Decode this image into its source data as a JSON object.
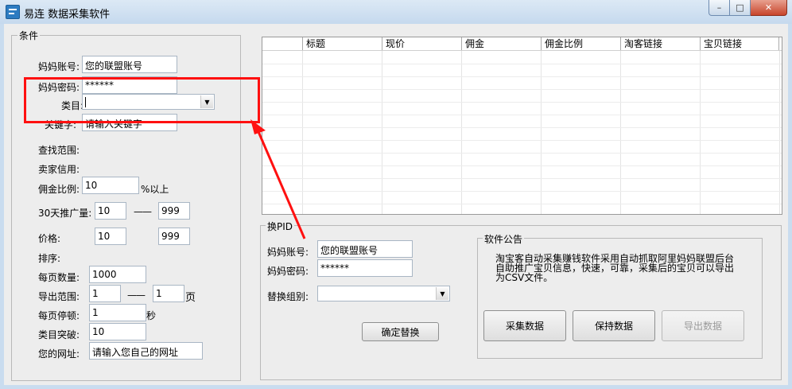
{
  "window": {
    "title": "易连 数据采集软件",
    "min": "–",
    "max": "□",
    "close": "✕"
  },
  "conditions": {
    "group_title": "条件",
    "mama_account": {
      "label": "妈妈账号:",
      "value": "您的联盟账号"
    },
    "mama_password": {
      "label": "妈妈密码:",
      "value": "******"
    },
    "category": {
      "label": "类目:",
      "value": ""
    },
    "keyword": {
      "label": "关键字:",
      "value": "请输入关键字"
    },
    "search_range_label": "查找范围:",
    "seller_credit_label": "卖家信用:",
    "commission_ratio": {
      "label": "佣金比例:",
      "value": "10",
      "suffix": "%以上"
    },
    "promo_30d": {
      "label": "30天推广量:",
      "from": "10",
      "sep": "——",
      "to": "999"
    },
    "price": {
      "label": "价格:",
      "from": "10",
      "to": "999"
    },
    "sort_label": "排序:",
    "per_page": {
      "label": "每页数量:",
      "value": "1000"
    },
    "export_range": {
      "label": "导出范围:",
      "from": "1",
      "sep": "——",
      "to": "1",
      "unit": "页"
    },
    "page_pause": {
      "label": "每页停顿:",
      "value": "1",
      "unit": "秒"
    },
    "category_break": {
      "label": "类目突破:",
      "value": "10"
    },
    "your_url": {
      "label": "您的网址:",
      "value": "请输入您自己的网址"
    }
  },
  "table": {
    "columns": [
      "标题",
      "现价",
      "佣金",
      "佣金比例",
      "淘客链接",
      "宝贝链接"
    ]
  },
  "replace_pid": {
    "group_title": "换PID",
    "mama_account": {
      "label": "妈妈账号:",
      "value": "您的联盟账号"
    },
    "mama_password": {
      "label": "妈妈密码:",
      "value": "******"
    },
    "replace_group": {
      "label": "替换组别:",
      "value": ""
    },
    "confirm_button": "确定替换"
  },
  "notice": {
    "group_title": "软件公告",
    "line1": "淘宝客自动采集赚钱软件采用自动抓取阿里妈妈联盟后台",
    "line2": "自助推广宝贝信息，快速，可靠，采集后的宝贝可以导出",
    "line3": "为CSV文件。"
  },
  "actions": {
    "collect": "采集数据",
    "save": "保持数据",
    "export": "导出数据"
  },
  "colors": {
    "annotation": "#ff1010",
    "titlebar": "#c5d9ee"
  },
  "icons": {
    "dropdown": "chevron-down-icon",
    "app": "app-icon"
  }
}
